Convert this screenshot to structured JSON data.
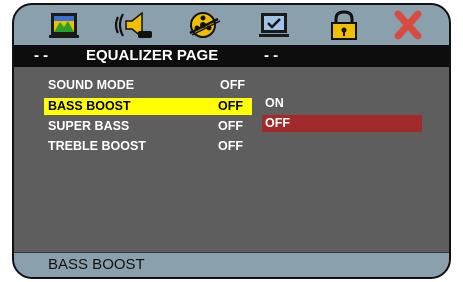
{
  "title_bar": {
    "left_dashes": "- -",
    "title": "EQUALIZER PAGE",
    "right_dashes": "- -"
  },
  "icons": [
    "general-setup-icon",
    "audio-setup-icon",
    "video-setup-icon",
    "preference-icon",
    "password-lock-icon",
    "exit-icon"
  ],
  "menu": {
    "items": [
      {
        "label": "SOUND MODE",
        "value": "OFF"
      },
      {
        "label": "BASS BOOST",
        "value": "OFF"
      },
      {
        "label": "SUPER BASS",
        "value": "OFF"
      },
      {
        "label": "TREBLE BOOST",
        "value": "OFF"
      }
    ],
    "selected_index": 1
  },
  "submenu": {
    "options": [
      "ON",
      "OFF"
    ],
    "selected_index": 1
  },
  "status_bar": {
    "text": "BASS BOOST"
  },
  "colors": {
    "panel": "#5e5e5e",
    "bar": "#8aa0ad",
    "selected_row": "#ffff00",
    "selected_option": "#a32a2a"
  }
}
